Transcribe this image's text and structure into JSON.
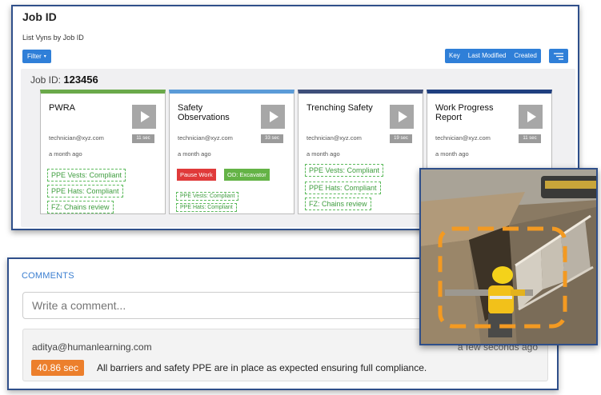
{
  "header": {
    "title": "Job ID",
    "subtitle": "List Vyns by Job ID"
  },
  "toolbar": {
    "filter_label": "Filter",
    "sort_options": [
      "Key",
      "Last Modified",
      "Created"
    ]
  },
  "job": {
    "label": "Job ID:",
    "value": "123456"
  },
  "cards": [
    {
      "title": "PWRA",
      "duration": "11 sec",
      "email": "technician@xyz.com",
      "ago": "a month ago",
      "accent": "#6aa94a",
      "tags": [
        "PPE Vests: Compliant",
        "PPE Hats: Compliant",
        "FZ: Chains review"
      ]
    },
    {
      "title": "Safety Observations",
      "duration": "33 sec",
      "email": "technician@xyz.com",
      "ago": "a month ago",
      "accent": "#5b9bd8",
      "pills": [
        {
          "label": "Pause Work",
          "color": "#e03a3a"
        },
        {
          "label": "OD: Excavator",
          "color": "#64b346"
        }
      ],
      "tags": [
        "PPE Vests: Compliant",
        "PPE Hats: Compliant"
      ]
    },
    {
      "title": "Trenching Safety",
      "duration": "19 sec",
      "email": "technician@xyz.com",
      "ago": "a month ago",
      "accent": "#3e4f7a",
      "tags": [
        "PPE Vests: Compliant",
        "PPE Hats: Compliant",
        "FZ: Chains review"
      ]
    },
    {
      "title": "Work Progress Report",
      "duration": "11 sec",
      "email": "technician@xyz.com",
      "ago": "a month ago",
      "accent": "#1f3f80",
      "tags": []
    }
  ],
  "comments": {
    "heading": "COMMENTS",
    "placeholder": "Write a comment...",
    "items": [
      {
        "author": "aditya@humanlearning.com",
        "time": "a few seconds ago",
        "timestamp": "40.86 sec",
        "text": "All barriers and safety PPE are in place as expected ensuring full compliance."
      }
    ]
  },
  "colors": {
    "primary": "#2f7fd8",
    "frame": "#2f4f8a",
    "highlight": "#f39a22",
    "tag_green": "#3f9d3f"
  }
}
